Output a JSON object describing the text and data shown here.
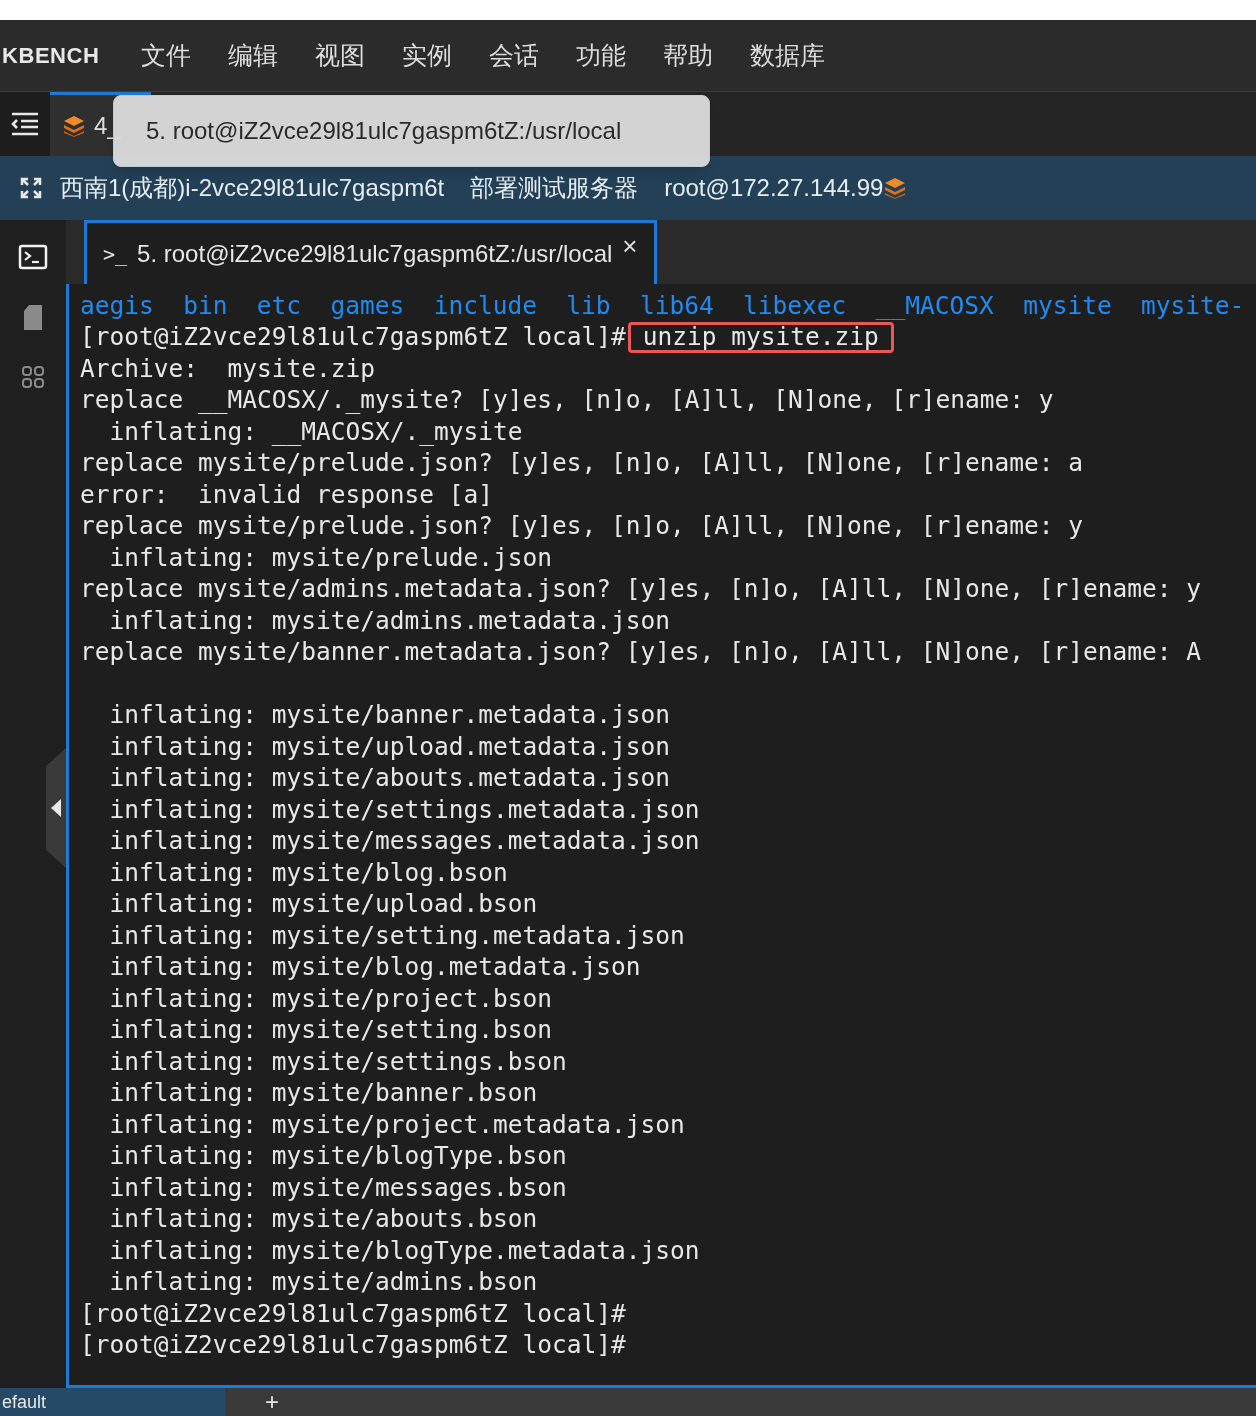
{
  "app_title": "KBENCH",
  "menu": [
    "文件",
    "编辑",
    "视图",
    "实例",
    "会话",
    "功能",
    "帮助",
    "数据库"
  ],
  "session_tabs": [
    {
      "label": "4_",
      "selected": true
    }
  ],
  "tooltip": "5. root@iZ2vce29l81ulc7gaspm6tZ:/usr/local",
  "info_bar": {
    "instance": "西南1(成都)i-2vce29l81ulc7gaspm6t",
    "server_name": "部署测试服务器",
    "login": "root@172.27.144.99"
  },
  "sidebar": [
    {
      "kind": "terminal",
      "selected": true
    },
    {
      "kind": "file",
      "selected": false
    },
    {
      "kind": "grid",
      "selected": false
    }
  ],
  "terminal_tabs": [
    {
      "prompt_mark": ">_",
      "label": "5. root@iZ2vce29l81ulc7gaspm6tZ:/usr/local",
      "close": "×",
      "selected": true
    }
  ],
  "terminal_lines": [
    {
      "kind": "listing",
      "items": [
        "aegis",
        "bin",
        "etc",
        "games",
        "include",
        "lib",
        "lib64",
        "libexec",
        "__MACOSX",
        "mysite",
        "mysite-"
      ]
    },
    {
      "kind": "prompt",
      "prompt": "[root@iZ2vce29l81ulc7gaspm6tZ local]#",
      "command": "unzip mysite.zip",
      "highlighted": true
    },
    {
      "kind": "text",
      "text": "Archive:  mysite.zip"
    },
    {
      "kind": "text",
      "text": "replace __MACOSX/._mysite? [y]es, [n]o, [A]ll, [N]one, [r]ename: y"
    },
    {
      "kind": "text",
      "text": "  inflating: __MACOSX/._mysite"
    },
    {
      "kind": "text",
      "text": "replace mysite/prelude.json? [y]es, [n]o, [A]ll, [N]one, [r]ename: a"
    },
    {
      "kind": "text",
      "text": "error:  invalid response [a]"
    },
    {
      "kind": "text",
      "text": "replace mysite/prelude.json? [y]es, [n]o, [A]ll, [N]one, [r]ename: y"
    },
    {
      "kind": "text",
      "text": "  inflating: mysite/prelude.json"
    },
    {
      "kind": "text",
      "text": "replace mysite/admins.metadata.json? [y]es, [n]o, [A]ll, [N]one, [r]ename: y"
    },
    {
      "kind": "text",
      "text": "  inflating: mysite/admins.metadata.json"
    },
    {
      "kind": "text",
      "text": "replace mysite/banner.metadata.json? [y]es, [n]o, [A]ll, [N]one, [r]ename: A"
    },
    {
      "kind": "blank"
    },
    {
      "kind": "text",
      "text": "  inflating: mysite/banner.metadata.json"
    },
    {
      "kind": "text",
      "text": "  inflating: mysite/upload.metadata.json"
    },
    {
      "kind": "text",
      "text": "  inflating: mysite/abouts.metadata.json"
    },
    {
      "kind": "text",
      "text": "  inflating: mysite/settings.metadata.json"
    },
    {
      "kind": "text",
      "text": "  inflating: mysite/messages.metadata.json"
    },
    {
      "kind": "text",
      "text": "  inflating: mysite/blog.bson"
    },
    {
      "kind": "text",
      "text": "  inflating: mysite/upload.bson"
    },
    {
      "kind": "text",
      "text": "  inflating: mysite/setting.metadata.json"
    },
    {
      "kind": "text",
      "text": "  inflating: mysite/blog.metadata.json"
    },
    {
      "kind": "text",
      "text": "  inflating: mysite/project.bson"
    },
    {
      "kind": "text",
      "text": "  inflating: mysite/setting.bson"
    },
    {
      "kind": "text",
      "text": "  inflating: mysite/settings.bson"
    },
    {
      "kind": "text",
      "text": "  inflating: mysite/banner.bson"
    },
    {
      "kind": "text",
      "text": "  inflating: mysite/project.metadata.json"
    },
    {
      "kind": "text",
      "text": "  inflating: mysite/blogType.bson"
    },
    {
      "kind": "text",
      "text": "  inflating: mysite/messages.bson"
    },
    {
      "kind": "text",
      "text": "  inflating: mysite/abouts.bson"
    },
    {
      "kind": "text",
      "text": "  inflating: mysite/blogType.metadata.json"
    },
    {
      "kind": "text",
      "text": "  inflating: mysite/admins.bson"
    },
    {
      "kind": "prompt",
      "prompt": "[root@iZ2vce29l81ulc7gaspm6tZ local]#"
    },
    {
      "kind": "prompt",
      "prompt": "[root@iZ2vce29l81ulc7gaspm6tZ local]#"
    }
  ],
  "bottom_tabs": [
    {
      "label": "efault",
      "selected": true
    }
  ],
  "add_tab": "+"
}
